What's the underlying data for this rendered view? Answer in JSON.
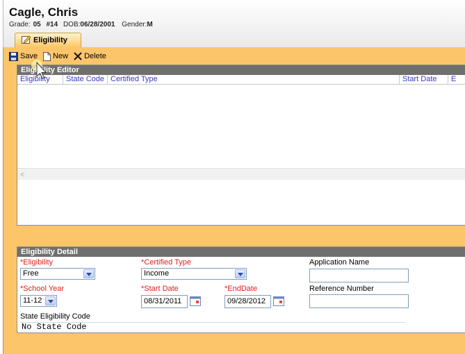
{
  "student": {
    "name": "Cagle, Chris",
    "grade_label": "Grade:",
    "grade": "05",
    "number": "#14",
    "dob_label": "DOB:",
    "dob": "06/28/2001",
    "gender_label": "Gender:",
    "gender": "M"
  },
  "tab": {
    "label": "Eligibility",
    "icon": "eligibility-tab-icon"
  },
  "toolbar": {
    "save_label": "Save",
    "new_label": "New",
    "delete_label": "Delete"
  },
  "editor": {
    "title": "Eligibility Editor",
    "columns": [
      "Eligibility",
      "State Code",
      "Certified Type",
      "Start Date",
      "E"
    ],
    "rows": []
  },
  "detail": {
    "title": "Eligibility Detail",
    "eligibility_label": "*Eligibility",
    "eligibility_value": "Free",
    "certified_type_label": "*Certified Type",
    "certified_type_value": "Income",
    "application_name_label": "Application Name",
    "application_name_value": "",
    "school_year_label": "*School Year",
    "school_year_value": "11-12",
    "start_date_label": "*Start Date",
    "start_date_value": "08/31/2011",
    "end_date_label": "*EndDate",
    "end_date_value": "09/28/2012",
    "reference_number_label": "Reference Number",
    "reference_number_value": "",
    "state_code_label": "State Eligibility Code",
    "state_code_value": "No State Code"
  },
  "colors": {
    "workarea": "#fdc56a",
    "panel_title": "#6f6f6f",
    "required_label": "#e0201b",
    "column_header": "#3a37c8"
  }
}
